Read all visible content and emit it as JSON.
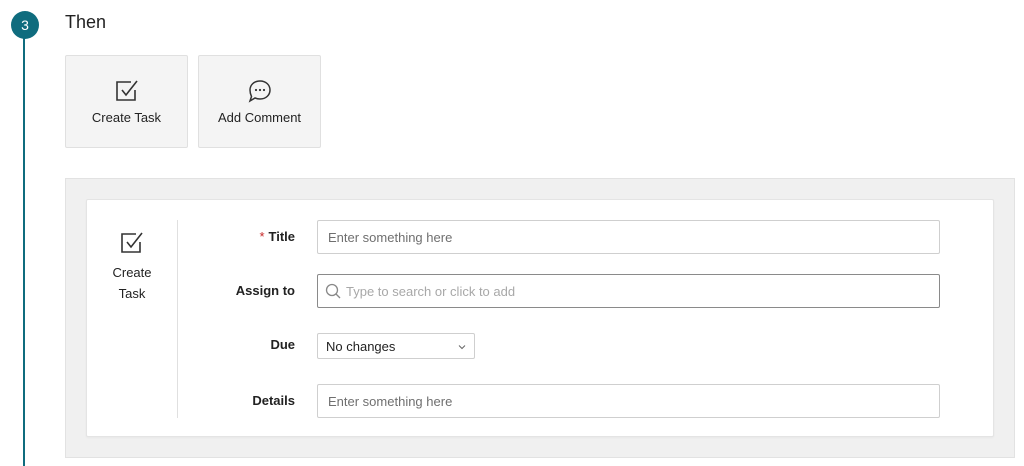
{
  "step": {
    "number": "3",
    "title": "Then"
  },
  "actions": [
    {
      "label": "Create Task",
      "icon": "checkbox-icon"
    },
    {
      "label": "Add Comment",
      "icon": "comment-icon"
    }
  ],
  "panel": {
    "label": "Create Task"
  },
  "form": {
    "title": {
      "label": "Title",
      "required_mark": "*",
      "placeholder": "Enter something here"
    },
    "assign": {
      "label": "Assign to",
      "placeholder": "Type to search or click to add"
    },
    "due": {
      "label": "Due",
      "value": "No changes"
    },
    "details": {
      "label": "Details",
      "placeholder": "Enter something here"
    }
  },
  "colors": {
    "accent": "#0f6c7e",
    "required": "#c62828"
  }
}
